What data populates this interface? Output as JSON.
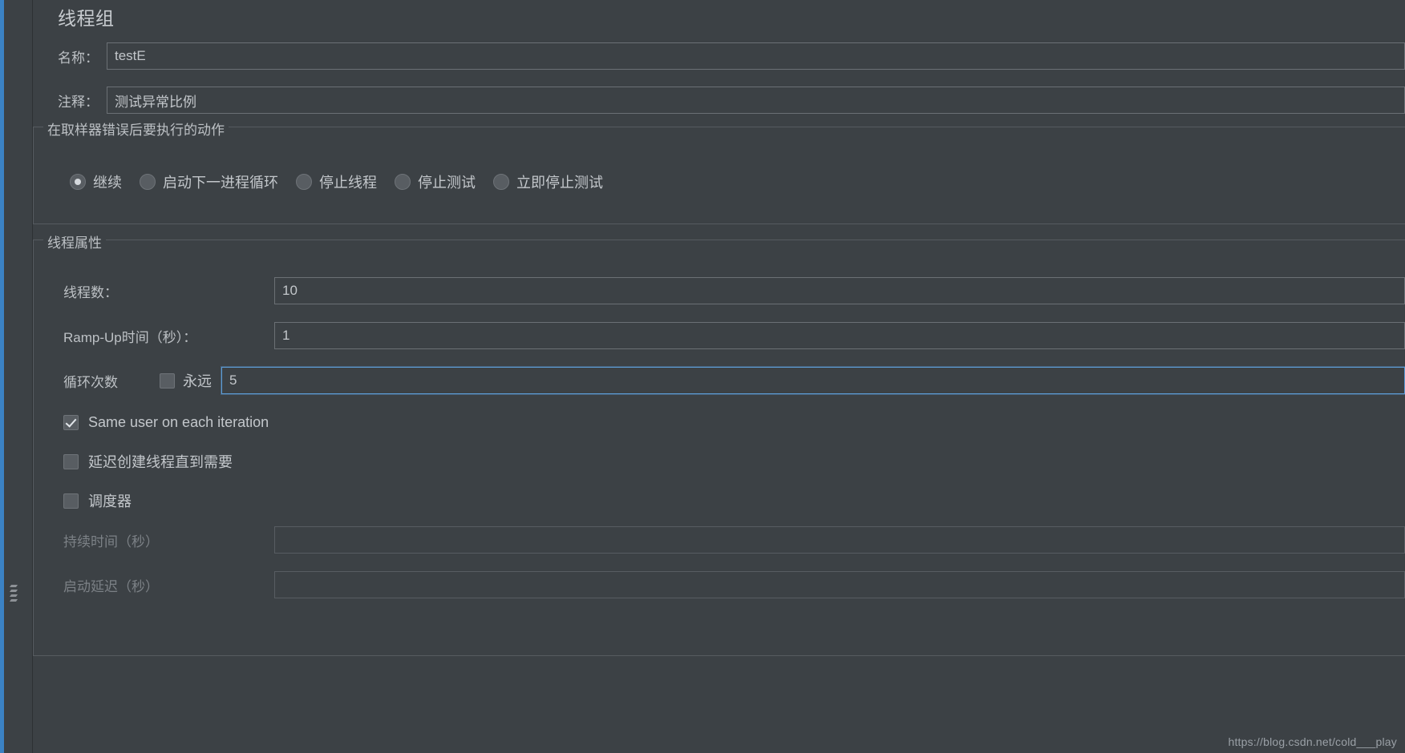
{
  "panel": {
    "title": "线程组"
  },
  "fields": {
    "name_label": "名称：",
    "name_value": "testE",
    "comment_label": "注释：",
    "comment_value": "测试异常比例"
  },
  "on_sampler_error": {
    "group_title": "在取样器错误后要执行的动作",
    "options": [
      {
        "label": "继续",
        "selected": true
      },
      {
        "label": "启动下一进程循环",
        "selected": false
      },
      {
        "label": "停止线程",
        "selected": false
      },
      {
        "label": "停止测试",
        "selected": false
      },
      {
        "label": "立即停止测试",
        "selected": false
      }
    ]
  },
  "thread_properties": {
    "group_title": "线程属性",
    "num_threads_label": "线程数：",
    "num_threads_value": "10",
    "ramp_up_label": "Ramp-Up时间（秒）：",
    "ramp_up_value": "1",
    "loop_count_label": "循环次数",
    "forever_label": "永远",
    "forever_checked": false,
    "loop_count_value": "5",
    "loop_count_focused": true,
    "same_user_label": "Same user on each iteration",
    "same_user_checked": true,
    "delay_thread_label": "延迟创建线程直到需要",
    "delay_thread_checked": false,
    "scheduler_label": "调度器",
    "scheduler_checked": false,
    "duration_label": "持续时间（秒）",
    "duration_value": "",
    "duration_disabled": true,
    "startup_delay_label": "启动延迟（秒）",
    "startup_delay_value": "",
    "startup_delay_disabled": true
  },
  "watermark": {
    "text": "https://blog.csdn.net/cold___play"
  },
  "colors": {
    "background": "#3c4145",
    "accent": "#3b82c4",
    "focus_border": "#5d9cd6",
    "text": "#bdc1c5",
    "disabled_text": "#7c8186"
  }
}
